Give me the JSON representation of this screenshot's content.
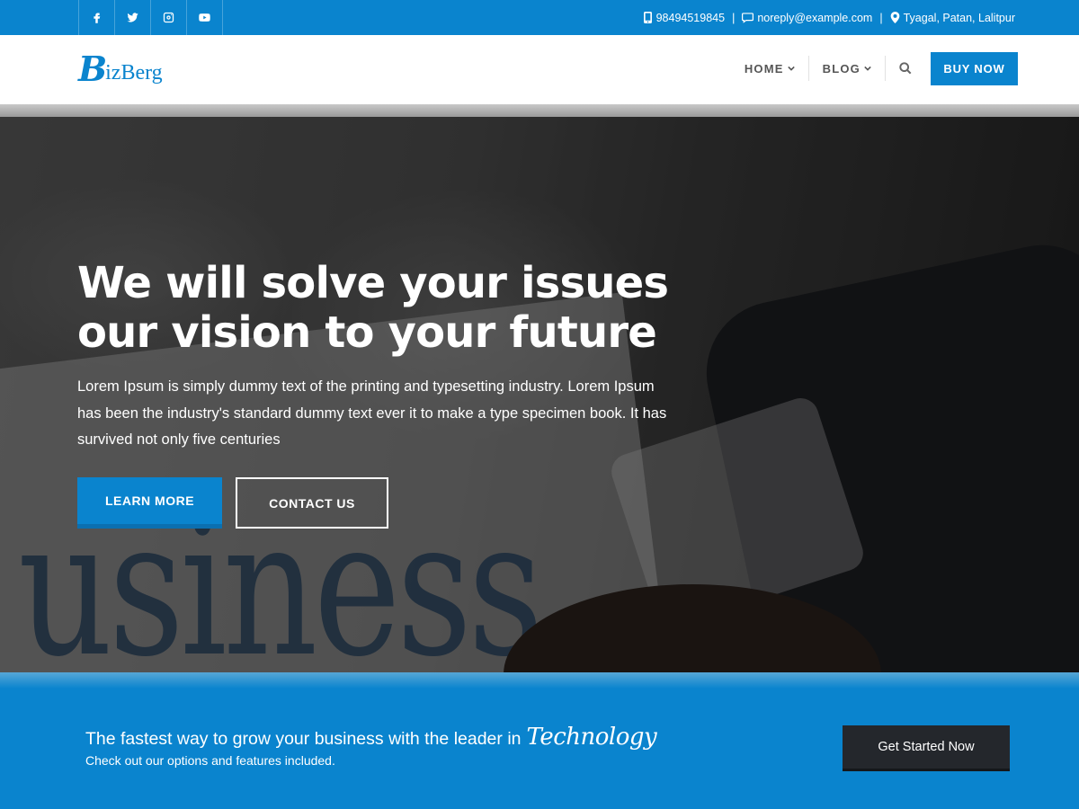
{
  "topbar": {
    "social": [
      "facebook-icon",
      "twitter-icon",
      "instagram-icon",
      "youtube-icon"
    ],
    "phone": "98494519845",
    "email": "noreply@example.com",
    "address": "Tyagal, Patan, Lalitpur",
    "separator": "|"
  },
  "header": {
    "logo_initial": "B",
    "logo_rest": "izBerg",
    "nav": {
      "home": "HOME",
      "blog": "BLOG"
    },
    "buy_label": "BUY NOW"
  },
  "hero": {
    "title_line1": "We will solve your issues",
    "title_line2": "our vision to your future",
    "text": "Lorem Ipsum is simply dummy text of the printing and typesetting industry. Lorem Ipsum has been the industry's standard dummy text ever it to make a type specimen book. It has survived not only five centuries",
    "learn_more": "LEARN MORE",
    "contact_us": "CONTACT US",
    "image_word": "usiness"
  },
  "cta": {
    "title": "The fastest way to grow your business with the leader in",
    "title_script": "Technology",
    "subtitle": "Check out our options and features included.",
    "button": "Get Started Now"
  },
  "colors": {
    "brand": "#0a84ce",
    "dark_button": "#24272c"
  }
}
